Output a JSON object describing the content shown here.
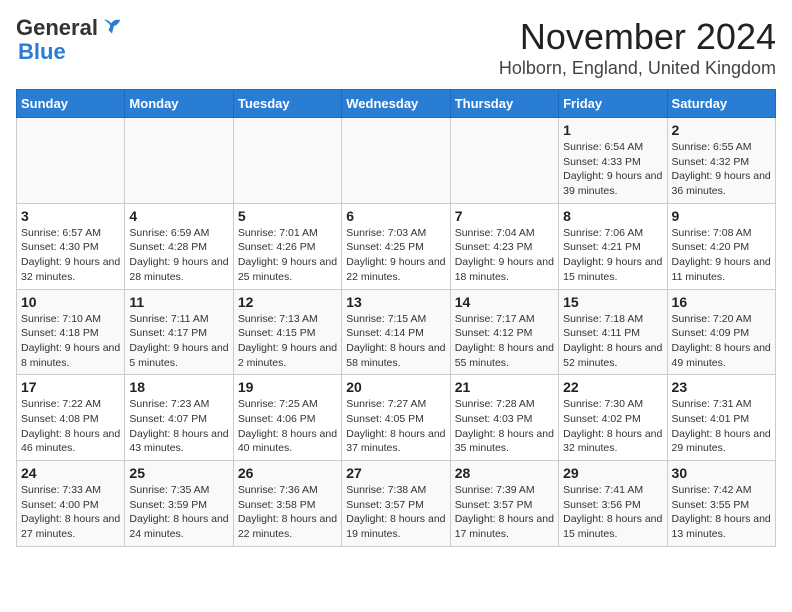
{
  "logo": {
    "general": "General",
    "blue": "Blue"
  },
  "title": "November 2024",
  "subtitle": "Holborn, England, United Kingdom",
  "days_of_week": [
    "Sunday",
    "Monday",
    "Tuesday",
    "Wednesday",
    "Thursday",
    "Friday",
    "Saturday"
  ],
  "weeks": [
    [
      {
        "day": "",
        "info": ""
      },
      {
        "day": "",
        "info": ""
      },
      {
        "day": "",
        "info": ""
      },
      {
        "day": "",
        "info": ""
      },
      {
        "day": "",
        "info": ""
      },
      {
        "day": "1",
        "info": "Sunrise: 6:54 AM\nSunset: 4:33 PM\nDaylight: 9 hours and 39 minutes."
      },
      {
        "day": "2",
        "info": "Sunrise: 6:55 AM\nSunset: 4:32 PM\nDaylight: 9 hours and 36 minutes."
      }
    ],
    [
      {
        "day": "3",
        "info": "Sunrise: 6:57 AM\nSunset: 4:30 PM\nDaylight: 9 hours and 32 minutes."
      },
      {
        "day": "4",
        "info": "Sunrise: 6:59 AM\nSunset: 4:28 PM\nDaylight: 9 hours and 28 minutes."
      },
      {
        "day": "5",
        "info": "Sunrise: 7:01 AM\nSunset: 4:26 PM\nDaylight: 9 hours and 25 minutes."
      },
      {
        "day": "6",
        "info": "Sunrise: 7:03 AM\nSunset: 4:25 PM\nDaylight: 9 hours and 22 minutes."
      },
      {
        "day": "7",
        "info": "Sunrise: 7:04 AM\nSunset: 4:23 PM\nDaylight: 9 hours and 18 minutes."
      },
      {
        "day": "8",
        "info": "Sunrise: 7:06 AM\nSunset: 4:21 PM\nDaylight: 9 hours and 15 minutes."
      },
      {
        "day": "9",
        "info": "Sunrise: 7:08 AM\nSunset: 4:20 PM\nDaylight: 9 hours and 11 minutes."
      }
    ],
    [
      {
        "day": "10",
        "info": "Sunrise: 7:10 AM\nSunset: 4:18 PM\nDaylight: 9 hours and 8 minutes."
      },
      {
        "day": "11",
        "info": "Sunrise: 7:11 AM\nSunset: 4:17 PM\nDaylight: 9 hours and 5 minutes."
      },
      {
        "day": "12",
        "info": "Sunrise: 7:13 AM\nSunset: 4:15 PM\nDaylight: 9 hours and 2 minutes."
      },
      {
        "day": "13",
        "info": "Sunrise: 7:15 AM\nSunset: 4:14 PM\nDaylight: 8 hours and 58 minutes."
      },
      {
        "day": "14",
        "info": "Sunrise: 7:17 AM\nSunset: 4:12 PM\nDaylight: 8 hours and 55 minutes."
      },
      {
        "day": "15",
        "info": "Sunrise: 7:18 AM\nSunset: 4:11 PM\nDaylight: 8 hours and 52 minutes."
      },
      {
        "day": "16",
        "info": "Sunrise: 7:20 AM\nSunset: 4:09 PM\nDaylight: 8 hours and 49 minutes."
      }
    ],
    [
      {
        "day": "17",
        "info": "Sunrise: 7:22 AM\nSunset: 4:08 PM\nDaylight: 8 hours and 46 minutes."
      },
      {
        "day": "18",
        "info": "Sunrise: 7:23 AM\nSunset: 4:07 PM\nDaylight: 8 hours and 43 minutes."
      },
      {
        "day": "19",
        "info": "Sunrise: 7:25 AM\nSunset: 4:06 PM\nDaylight: 8 hours and 40 minutes."
      },
      {
        "day": "20",
        "info": "Sunrise: 7:27 AM\nSunset: 4:05 PM\nDaylight: 8 hours and 37 minutes."
      },
      {
        "day": "21",
        "info": "Sunrise: 7:28 AM\nSunset: 4:03 PM\nDaylight: 8 hours and 35 minutes."
      },
      {
        "day": "22",
        "info": "Sunrise: 7:30 AM\nSunset: 4:02 PM\nDaylight: 8 hours and 32 minutes."
      },
      {
        "day": "23",
        "info": "Sunrise: 7:31 AM\nSunset: 4:01 PM\nDaylight: 8 hours and 29 minutes."
      }
    ],
    [
      {
        "day": "24",
        "info": "Sunrise: 7:33 AM\nSunset: 4:00 PM\nDaylight: 8 hours and 27 minutes."
      },
      {
        "day": "25",
        "info": "Sunrise: 7:35 AM\nSunset: 3:59 PM\nDaylight: 8 hours and 24 minutes."
      },
      {
        "day": "26",
        "info": "Sunrise: 7:36 AM\nSunset: 3:58 PM\nDaylight: 8 hours and 22 minutes."
      },
      {
        "day": "27",
        "info": "Sunrise: 7:38 AM\nSunset: 3:57 PM\nDaylight: 8 hours and 19 minutes."
      },
      {
        "day": "28",
        "info": "Sunrise: 7:39 AM\nSunset: 3:57 PM\nDaylight: 8 hours and 17 minutes."
      },
      {
        "day": "29",
        "info": "Sunrise: 7:41 AM\nSunset: 3:56 PM\nDaylight: 8 hours and 15 minutes."
      },
      {
        "day": "30",
        "info": "Sunrise: 7:42 AM\nSunset: 3:55 PM\nDaylight: 8 hours and 13 minutes."
      }
    ]
  ]
}
